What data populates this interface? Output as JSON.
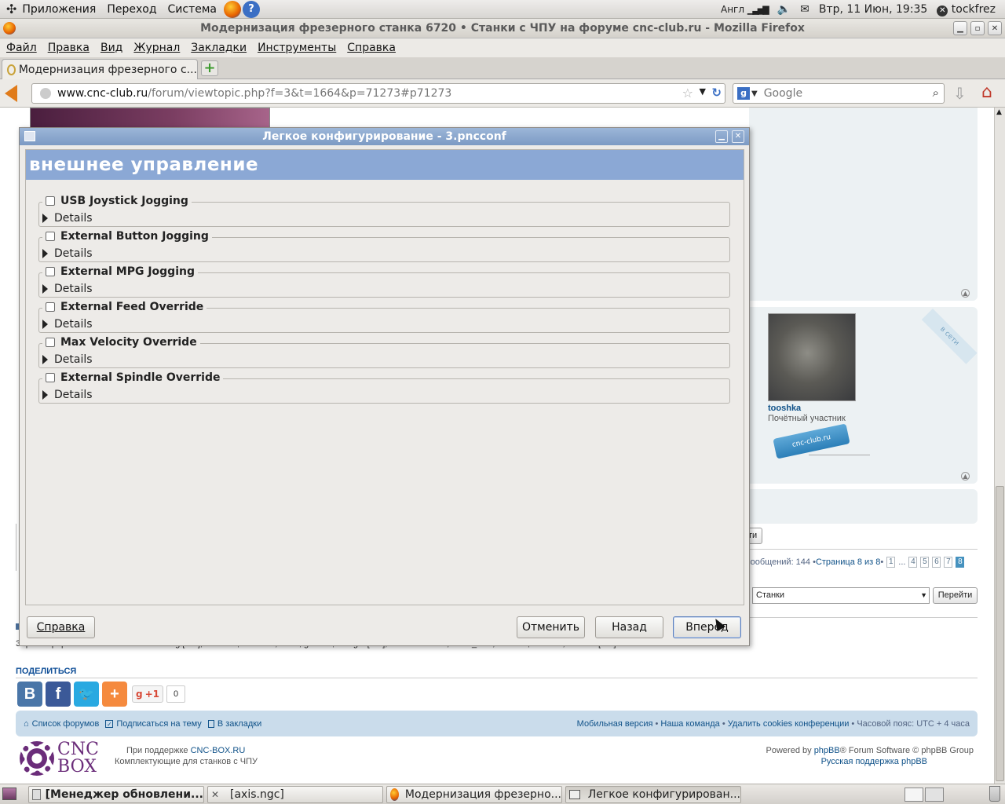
{
  "top_panel": {
    "menus": [
      "Приложения",
      "Переход",
      "Система"
    ],
    "keyboard_layout": "Англ",
    "datetime": "Втр, 11 Июн, 19:35",
    "user": "tockfrez"
  },
  "firefox": {
    "window_title": "Модернизация фрезерного станка 6720 • Станки с ЧПУ на форуме cnc-club.ru - Mozilla Firefox",
    "menubar": [
      "Файл",
      "Правка",
      "Вид",
      "Журнал",
      "Закладки",
      "Инструменты",
      "Справка"
    ],
    "tab_title": "Модернизация фрезерного с...",
    "url_domain": "www.cnc-club.ru",
    "url_path": "/forum/viewtopic.php?f=3&t=1664&p=71273#p71273",
    "search_placeholder": "Google"
  },
  "page": {
    "member": {
      "online_badge": "в сети",
      "name": "tooshka",
      "rank": "Почётный участник",
      "rank_badge": "cnc-club.ru"
    },
    "reply_button_fragment": "ти",
    "pagination": {
      "info_prefix": "сообщений: 144 • ",
      "info_link": "Страница 8 из 8",
      "info_sep": " •",
      "pages": [
        "1",
        "...",
        "4",
        "5",
        "6",
        "7",
        "8"
      ],
      "active_page": "8"
    },
    "jump": {
      "selected": "Станки",
      "button": "Перейти"
    },
    "registered_users": "Зарегистрированные пользователи: Bing [Bot], BlackOx, Cancvck, GoFf, gendos, Google [Bot], MSNbot Media, static_void, tockfrez, tooshka, Yandex [Bot]",
    "share": {
      "heading": "ПОДЕЛИТЬСЯ",
      "gplus": "+1",
      "gplus_count": "0"
    },
    "footer_nav": {
      "left": [
        "Список форумов",
        "Подписаться на тему",
        "В закладки"
      ],
      "right_links": [
        "Мобильная версия",
        "Наша команда",
        "Удалить cookies конференции"
      ],
      "timezone": "Часовой пояс: UTC + 4 часа"
    },
    "credits": {
      "logo_line1": "CNC",
      "logo_line2": "BOX",
      "support_prefix": "При поддержке ",
      "support_link": "CNC-BOX.RU",
      "support_line2": "Комплектующие для станков с ЧПУ",
      "powered_prefix": "Powered by ",
      "powered_link": "phpBB",
      "powered_suffix": "® Forum Software © phpBB Group",
      "ru_support": "Русская поддержка phpBB"
    }
  },
  "dialog": {
    "title": "Легкое конфигурирование - 3.pncconf",
    "header": "внешнее управление",
    "options": [
      {
        "label": "USB Joystick Jogging",
        "checked": false,
        "details": "Details"
      },
      {
        "label": "External Button Jogging",
        "checked": false,
        "details": "Details"
      },
      {
        "label": "External MPG Jogging",
        "checked": false,
        "details": "Details"
      },
      {
        "label": "External Feed Override",
        "checked": false,
        "details": "Details"
      },
      {
        "label": "Max Velocity Override",
        "checked": false,
        "details": "Details"
      },
      {
        "label": "External Spindle Override",
        "checked": false,
        "details": "Details"
      }
    ],
    "buttons": {
      "help": "Справка",
      "cancel": "Отменить",
      "back": "Назад",
      "forward": "Вперёд"
    }
  },
  "taskbar": {
    "tasks": [
      "[Менеджер обновлени...",
      "[axis.ngc]",
      "Модернизация фрезерно...",
      "Легкое конфигурирован..."
    ]
  },
  "colors": {
    "dialog_header_bg": "#8ba8d5",
    "dialog_title_bg": "#7c9ac4",
    "forum_link": "#105289",
    "panel_bg": "#ecf1f3"
  }
}
